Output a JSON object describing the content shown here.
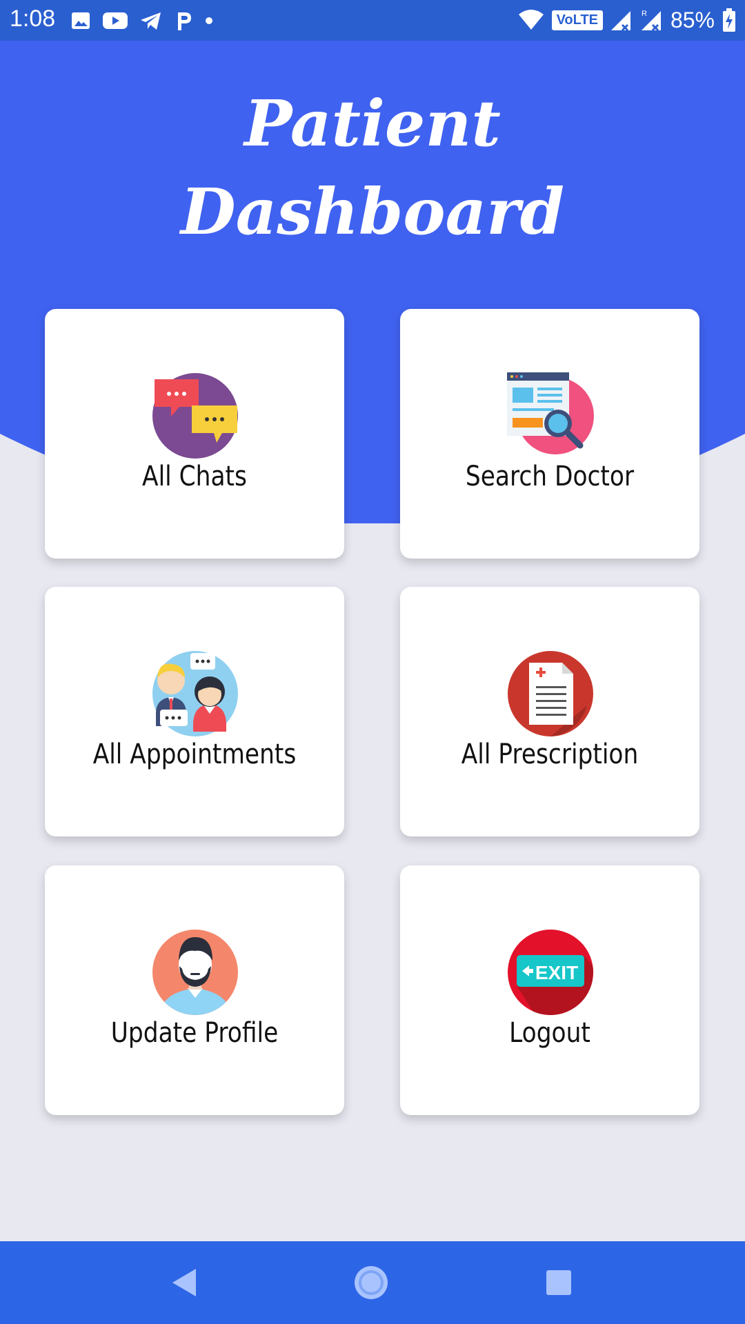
{
  "status_bar": {
    "time": "1:08",
    "network_badge": "VoLTE",
    "battery": "85%",
    "left_icons": [
      "image-icon",
      "youtube-icon",
      "telegram-icon",
      "p-app-icon",
      "dot-icon"
    ],
    "right_icons": [
      "wifi-icon",
      "volte-badge",
      "signal-icon",
      "roaming-signal-icon",
      "battery-charging-icon"
    ]
  },
  "header": {
    "title_line1": "Patient",
    "title_line2": "Dashboard"
  },
  "colors": {
    "primary": "#4062f0",
    "status_bar": "#2a5fd0",
    "nav_bar": "#2c65e6",
    "background": "#e8e8f1",
    "card": "#ffffff"
  },
  "cards": [
    {
      "label": "All Chats",
      "icon": "chat-bubbles-icon"
    },
    {
      "label": "Search Doctor",
      "icon": "search-document-icon"
    },
    {
      "label": "All Appointments",
      "icon": "people-conversation-icon"
    },
    {
      "label": "All Prescription",
      "icon": "prescription-document-icon"
    },
    {
      "label": "Update Profile",
      "icon": "user-avatar-icon"
    },
    {
      "label": "Logout",
      "icon": "exit-sign-icon"
    }
  ],
  "exit_sign_text": "EXIT",
  "nav": {
    "buttons": [
      "back-button",
      "home-button",
      "recents-button"
    ]
  }
}
